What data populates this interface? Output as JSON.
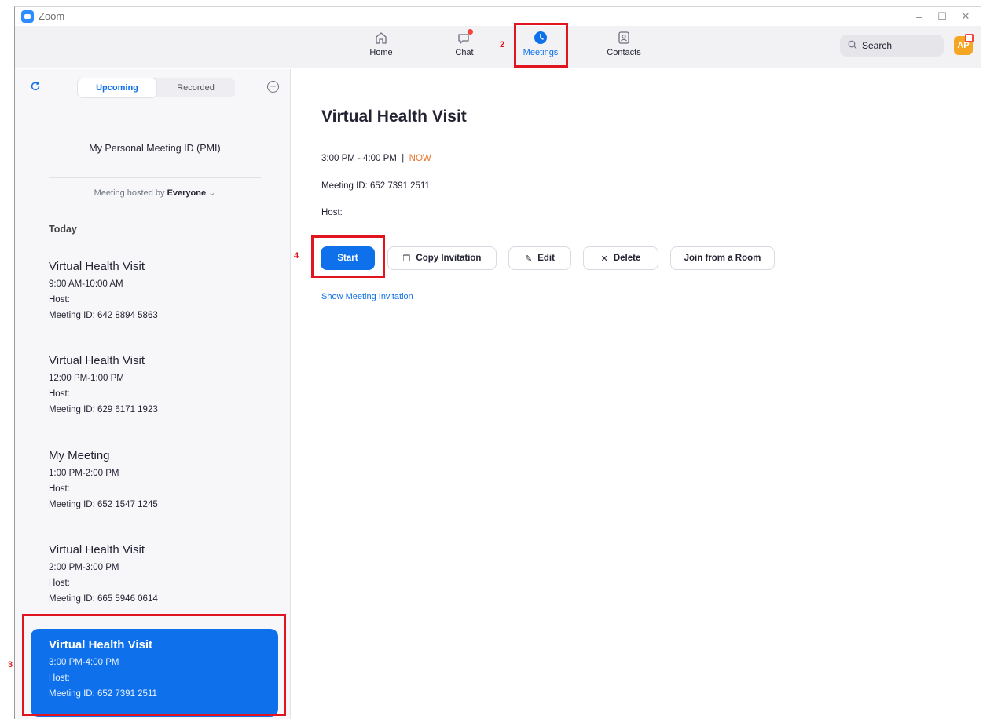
{
  "window": {
    "title": "Zoom",
    "controls": [
      "–",
      "☐",
      "✕"
    ]
  },
  "nav": {
    "items": [
      {
        "label": "Home",
        "icon": "home-icon"
      },
      {
        "label": "Chat",
        "icon": "chat-icon"
      },
      {
        "label": "Meetings",
        "icon": "clock-icon",
        "active": true
      },
      {
        "label": "Contacts",
        "icon": "contacts-icon"
      }
    ],
    "search_label": "Search",
    "avatar_initials": "AP"
  },
  "sidebar": {
    "tabs": [
      "Upcoming",
      "Recorded"
    ],
    "active_tab": "Upcoming",
    "pmi_label": "My Personal Meeting ID (PMI)",
    "hosted_prefix": "Meeting hosted by",
    "hosted_value": "Everyone",
    "section": "Today",
    "meetings": [
      {
        "title": "Virtual Health Visit",
        "time": "9:00 AM-10:00 AM",
        "host": "Host:",
        "id": "Meeting ID: 642 8894 5863"
      },
      {
        "title": "Virtual Health Visit",
        "time": "12:00 PM-1:00 PM",
        "host": "Host:",
        "id": "Meeting ID: 629 6171 1923"
      },
      {
        "title": "My Meeting",
        "time": "1:00 PM-2:00 PM",
        "host": "Host:",
        "id": "Meeting ID: 652 1547 1245"
      },
      {
        "title": "Virtual Health Visit",
        "time": "2:00 PM-3:00 PM",
        "host": "Host:",
        "id": "Meeting ID: 665 5946 0614"
      },
      {
        "title": "Virtual Health Visit",
        "time": "3:00 PM-4:00 PM",
        "host": "Host:",
        "id": "Meeting ID: 652 7391 2511",
        "selected": true
      }
    ]
  },
  "detail": {
    "title": "Virtual Health Visit",
    "time": "3:00 PM - 4:00 PM",
    "separator": "|",
    "now": "NOW",
    "meeting_id": "Meeting ID: 652 7391 2511",
    "host": "Host:",
    "buttons": {
      "start": "Start",
      "copy": "Copy Invitation",
      "edit": "Edit",
      "delete": "Delete",
      "join_room": "Join from a Room"
    },
    "show_invitation": "Show Meeting Invitation"
  },
  "annotations": {
    "step2": "2",
    "step3": "3",
    "step4": "4",
    "color": "#e0151f"
  },
  "colors": {
    "accent": "#0e71eb",
    "now": "#e8742a"
  }
}
